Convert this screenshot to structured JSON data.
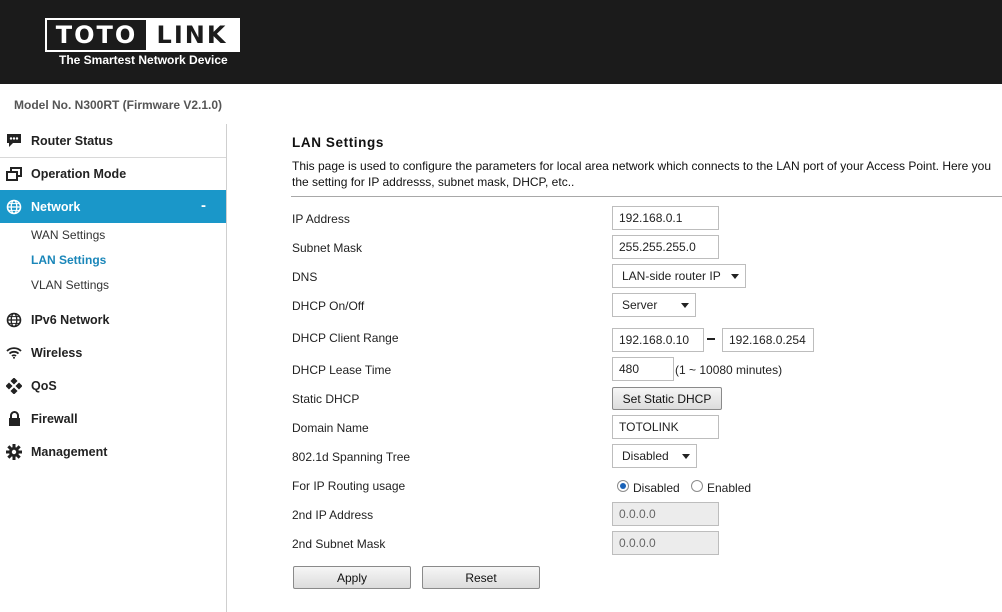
{
  "brand": {
    "logo_left": "TOTO",
    "logo_right": "LINK",
    "tagline": "The Smartest Network Device"
  },
  "model_info": "Model No. N300RT (Firmware V2.1.0)",
  "sidebar": {
    "items": [
      {
        "label": "Router Status",
        "icon": "chat-bubble-icon"
      },
      {
        "label": "Operation Mode",
        "icon": "windows-icon"
      },
      {
        "label": "Network",
        "icon": "globe-icon",
        "collapse": "-"
      },
      {
        "label": "IPv6 Network",
        "icon": "globe-icon"
      },
      {
        "label": "Wireless",
        "icon": "wifi-icon"
      },
      {
        "label": "QoS",
        "icon": "diamond-dots-icon"
      },
      {
        "label": "Firewall",
        "icon": "lock-icon"
      },
      {
        "label": "Management",
        "icon": "gear-icon"
      }
    ],
    "network_sub": [
      {
        "label": "WAN Settings"
      },
      {
        "label": "LAN Settings"
      },
      {
        "label": "VLAN Settings"
      }
    ],
    "active_color": "#1a97c9"
  },
  "main": {
    "title": "LAN Settings",
    "description_line1": "This page is used to configure the parameters for local area network which connects to the LAN port of your Access Point. Here you",
    "description_line2": "the setting for IP addresss, subnet mask, DHCP, etc..",
    "fields": {
      "ip_address": {
        "label": "IP Address",
        "value": "192.168.0.1"
      },
      "subnet_mask": {
        "label": "Subnet Mask",
        "value": "255.255.255.0"
      },
      "dns": {
        "label": "DNS",
        "value": "LAN-side router IP"
      },
      "dhcp": {
        "label": "DHCP On/Off",
        "value": "Server"
      },
      "dhcp_range": {
        "label": "DHCP Client Range",
        "start": "192.168.0.10",
        "end": "192.168.0.254"
      },
      "lease_time": {
        "label": "DHCP Lease Time",
        "value": "480",
        "hint": "(1 ~ 10080 minutes)"
      },
      "static_dhcp": {
        "label": "Static DHCP",
        "button": "Set Static DHCP"
      },
      "domain_name": {
        "label": "Domain Name",
        "value": "TOTOLINK"
      },
      "spanning_tree": {
        "label": "802.1d Spanning Tree",
        "value": "Disabled"
      },
      "ip_routing": {
        "label": "For IP Routing usage",
        "option_disabled": "Disabled",
        "option_enabled": "Enabled",
        "selected": "Disabled"
      },
      "second_ip": {
        "label": "2nd IP Address",
        "value": "0.0.0.0"
      },
      "second_mask": {
        "label": "2nd Subnet Mask",
        "value": "0.0.0.0"
      }
    },
    "buttons": {
      "apply": "Apply",
      "reset": "Reset"
    }
  }
}
